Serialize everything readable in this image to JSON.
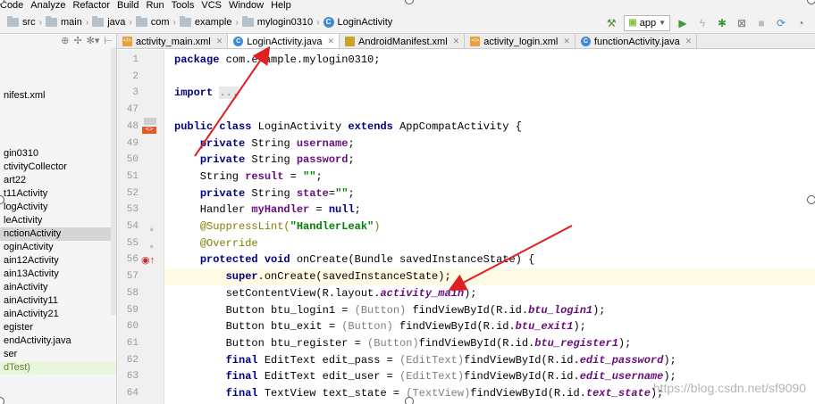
{
  "menu": [
    "Code",
    "Analyze",
    "Refactor",
    "Build",
    "Run",
    "Tools",
    "VCS",
    "Window",
    "Help"
  ],
  "breadcrumb": [
    "src",
    "main",
    "java",
    "com",
    "example",
    "mylogin0310",
    "LoginActivity"
  ],
  "run_config": "app",
  "tabs": [
    {
      "label": "activity_main.xml",
      "icon": "xml-file-icon",
      "active": false
    },
    {
      "label": "LoginActivity.java",
      "icon": "java-class-icon",
      "active": true
    },
    {
      "label": "AndroidManifest.xml",
      "icon": "manifest-icon",
      "active": false
    },
    {
      "label": "activity_login.xml",
      "icon": "xml-file-icon",
      "active": false
    },
    {
      "label": "functionActivity.java",
      "icon": "java-class-icon",
      "active": false
    }
  ],
  "project_tree": [
    {
      "label": "nifest.xml"
    },
    {
      "label": "gin0310"
    },
    {
      "label": "ctivityCollector"
    },
    {
      "label": "art22"
    },
    {
      "label": "t11Activity"
    },
    {
      "label": "logActivity"
    },
    {
      "label": "leActivity"
    },
    {
      "label": "nctionActivity",
      "selected": true
    },
    {
      "label": "oginActivity"
    },
    {
      "label": "ain12Activity"
    },
    {
      "label": "ain13Activity"
    },
    {
      "label": "ainActivity"
    },
    {
      "label": "ainActivity11"
    },
    {
      "label": "ainActivity21"
    },
    {
      "label": "egister"
    },
    {
      "label": "endActivity.java"
    },
    {
      "label": "ser"
    },
    {
      "label": "dTest)",
      "green": true
    }
  ],
  "code_lines": [
    {
      "num": "1",
      "html": "<span class=\"kw\">package</span> com.example.mylogin0310;"
    },
    {
      "num": "2",
      "html": ""
    },
    {
      "num": "3",
      "html": "<span class=\"kw\">import</span> <span class=\"fold\">...</span>"
    },
    {
      "num": "47",
      "html": ""
    },
    {
      "num": "48",
      "html": "<span class=\"kw\">public class</span> LoginActivity <span class=\"kw\">extends</span> AppCompatActivity {"
    },
    {
      "num": "49",
      "html": "    <span class=\"kw\">private</span> String <span class=\"fld\">username</span>;"
    },
    {
      "num": "50",
      "html": "    <span class=\"kw\">private</span> String <span class=\"fld\">password</span>;"
    },
    {
      "num": "51",
      "html": "    String <span class=\"fld\">result</span> = <span class=\"str\">\"\"</span>;"
    },
    {
      "num": "52",
      "html": "    <span class=\"kw\">private</span> String <span class=\"fld\">state</span>=<span class=\"str\">\"\"</span>;"
    },
    {
      "num": "53",
      "html": "    Handler <span class=\"fld\">myHandler</span> = <span class=\"kw\">null</span>;"
    },
    {
      "num": "54",
      "html": "    <span class=\"ann\">@SuppressLint(</span><span class=\"str\">\"HandlerLeak\"</span><span class=\"ann\">)</span>"
    },
    {
      "num": "55",
      "html": "    <span class=\"ann\">@Override</span>"
    },
    {
      "num": "56",
      "html": "    <span class=\"kw\">protected void</span> onCreate(Bundle savedInstanceState) {"
    },
    {
      "num": "57",
      "html": "        <span class=\"kw\">super</span>.onCreate(savedInstanceState);",
      "current": true
    },
    {
      "num": "58",
      "html": "        setContentView(R.layout.<span class=\"fldi\">activity_main</span>);"
    },
    {
      "num": "59",
      "html": "        Button btu_login1 = <span class=\"cast\">(Button)</span> findViewById(R.id.<span class=\"fldi\">btu_login1</span>);"
    },
    {
      "num": "60",
      "html": "        Button btu_exit = <span class=\"cast\">(Button)</span> findViewById(R.id.<span class=\"fldi\">btu_exit1</span>);"
    },
    {
      "num": "61",
      "html": "        Button btu_register = <span class=\"cast\">(Button)</span>findViewById(R.id.<span class=\"fldi\">btu_register1</span>);"
    },
    {
      "num": "62",
      "html": "        <span class=\"kw\">final</span> EditText edit_pass = <span class=\"cast\">(EditText)</span>findViewById(R.id.<span class=\"fldi\">edit_password</span>);"
    },
    {
      "num": "63",
      "html": "        <span class=\"kw\">final</span> EditText edit_user = <span class=\"cast\">(EditText)</span>findViewById(R.id.<span class=\"fldi\">edit_username</span>);"
    },
    {
      "num": "64",
      "html": "        <span class=\"kw\">final</span> TextView text_state = <span class=\"cast\">(TextView)</span>findViewById(R.id.<span class=\"fldi\">text_state</span>);"
    }
  ],
  "watermark": "https://blog.csdn.net/sf9090"
}
